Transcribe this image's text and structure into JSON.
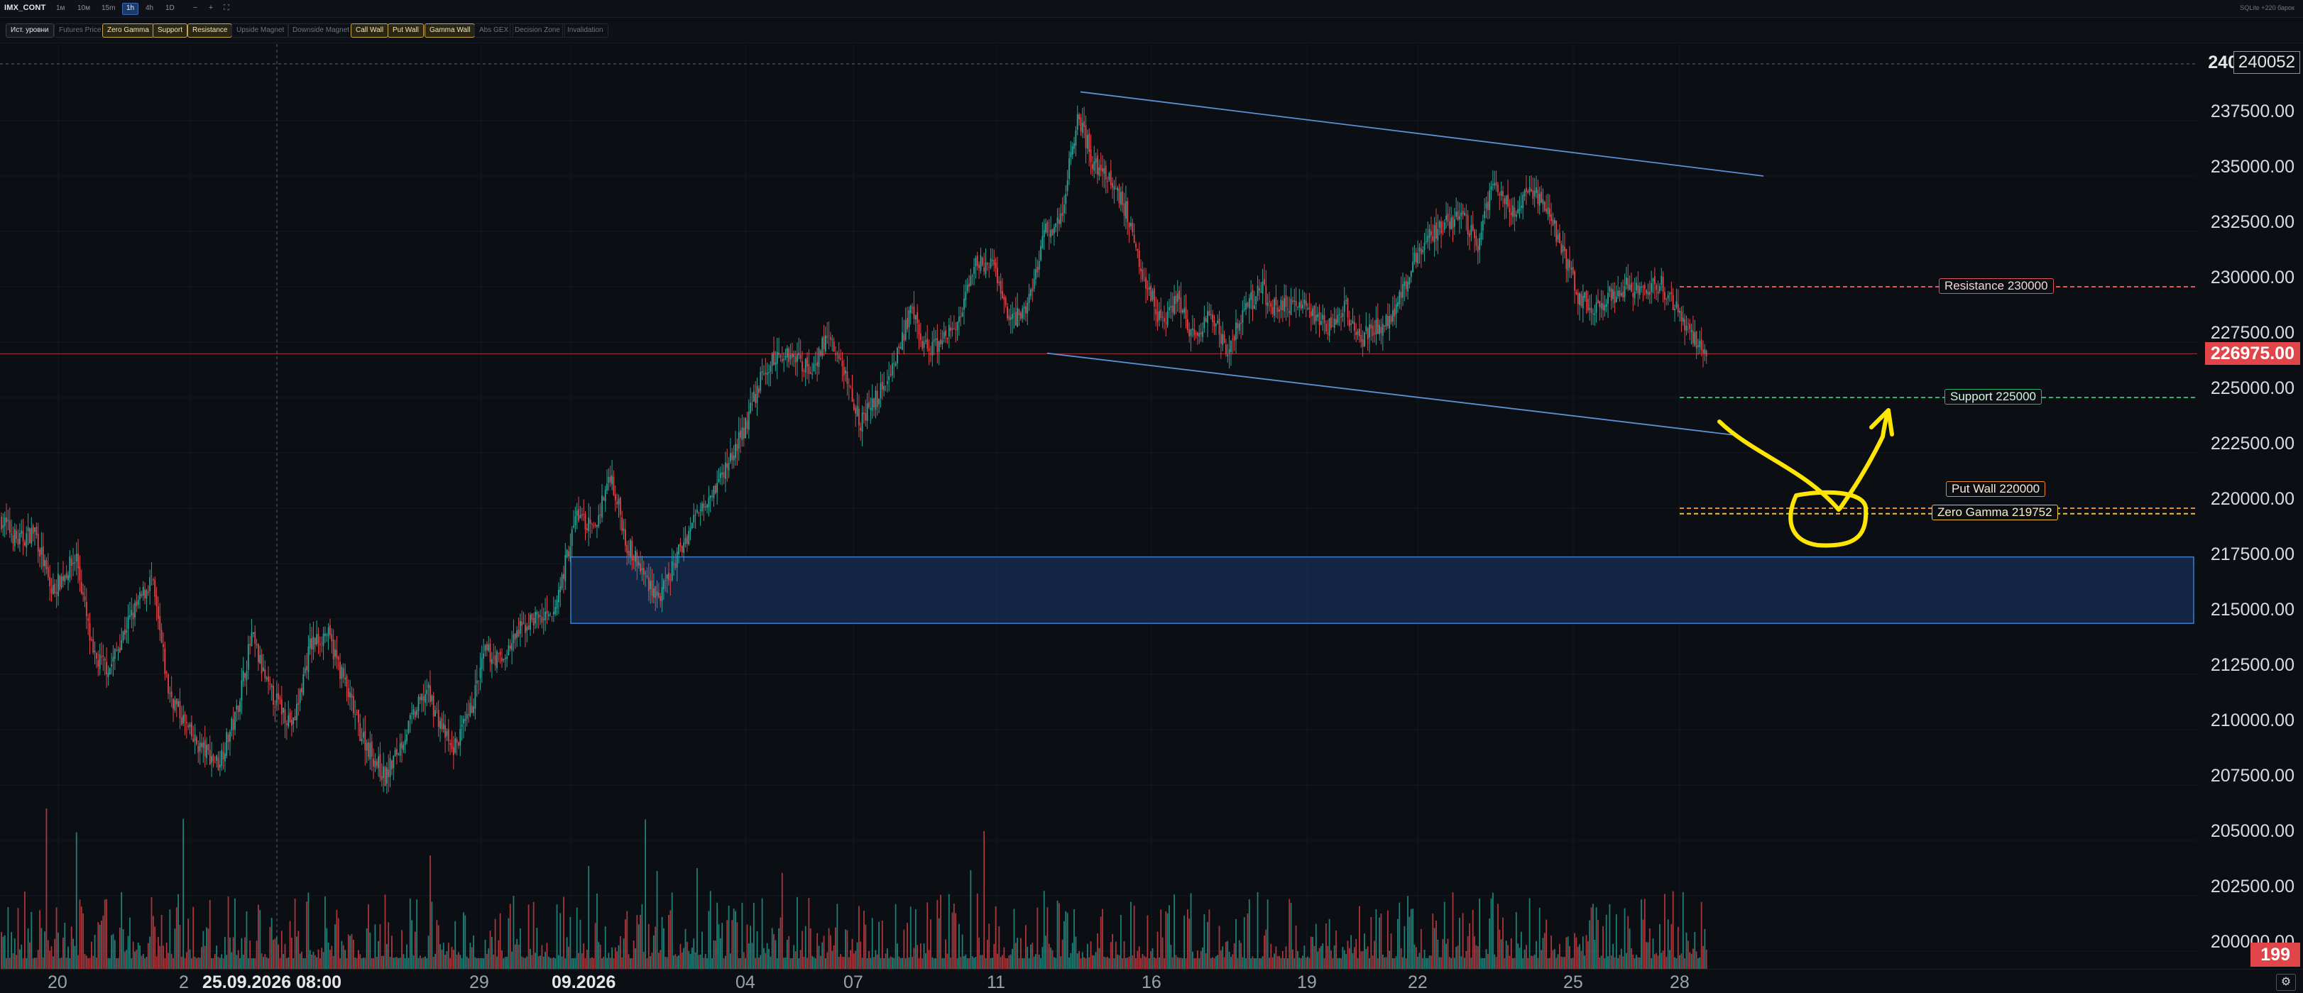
{
  "app": {
    "symbol": "IMX_CONT",
    "timeframes": [
      "1м",
      "10м",
      "15m",
      "1h",
      "4h",
      "1D"
    ],
    "active_timeframe": "1h",
    "top_right_text": "SQLite  +220 барок"
  },
  "layers": [
    {
      "label": "Ист. уровни",
      "state": "plain"
    },
    {
      "label": "Futures Price",
      "state": "off"
    },
    {
      "label": "Zero Gamma",
      "state": "on"
    },
    {
      "label": "Support",
      "state": "on"
    },
    {
      "label": "Resistance",
      "state": "on"
    },
    {
      "label": "Upside Magnet",
      "state": "off"
    },
    {
      "label": "Downside Magnet",
      "state": "off"
    },
    {
      "label": "Call Wall",
      "state": "on"
    },
    {
      "label": "Put Wall",
      "state": "on"
    },
    {
      "label": "Gamma Wall",
      "state": "on"
    },
    {
      "label": "Abs GEX",
      "state": "off"
    },
    {
      "label": "Decision Zone",
      "state": "off"
    },
    {
      "label": "Invalidation",
      "state": "off"
    }
  ],
  "price_axis": {
    "ticks": [
      "237500.00",
      "235000.00",
      "232500.00",
      "230000.00",
      "227500.00",
      "225000.00",
      "222500.00",
      "220000.00",
      "217500.00",
      "215000.00",
      "212500.00",
      "210000.00",
      "207500.00",
      "205000.00",
      "202500.00",
      "200000.00"
    ],
    "top_cut_label": "240",
    "top_tag": "240052",
    "current_price": "226975.00",
    "volume_tag": "199"
  },
  "levels": {
    "resistance": "Resistance 230000",
    "support": "Support 225000",
    "put_wall": "Put Wall 220000",
    "zero_gamma": "Zero Gamma 219752"
  },
  "time_axis": [
    {
      "label": "20"
    },
    {
      "label": "2"
    },
    {
      "label": "25.09.2026 08:00",
      "bold": true
    },
    {
      "label": "29"
    },
    {
      "label": "09.2026",
      "bold": true
    },
    {
      "label": "04"
    },
    {
      "label": "07"
    },
    {
      "label": "11"
    },
    {
      "label": "16"
    },
    {
      "label": "19"
    },
    {
      "label": "22"
    },
    {
      "label": "25"
    },
    {
      "label": "28"
    }
  ],
  "colors": {
    "background": "#0b0e13",
    "bull": "#26a69a",
    "bear": "#e0454a",
    "resistance": "#e0545a",
    "support": "#2fb36c",
    "put_wall": "#ee8a2e",
    "zero_gamma": "#f2c12e",
    "channel": "#5b8fd6",
    "zone_fill": "#1a3a6b",
    "annotation": "#ffe600"
  },
  "chart_data": {
    "type": "candlestick",
    "y_range": [
      199000,
      241000
    ],
    "current_price": 226975,
    "levels": [
      {
        "name": "Resistance",
        "value": 230000
      },
      {
        "name": "Support",
        "value": 225000
      },
      {
        "name": "Put Wall",
        "value": 220000
      },
      {
        "name": "Zero Gamma",
        "value": 219752
      }
    ],
    "zone": {
      "low": 214800,
      "high": 217800
    },
    "price_path": [
      [
        0,
        219500
      ],
      [
        10,
        218500
      ],
      [
        20,
        219000
      ],
      [
        30,
        216200
      ],
      [
        45,
        217800
      ],
      [
        55,
        213200
      ],
      [
        65,
        212800
      ],
      [
        75,
        214700
      ],
      [
        90,
        216800
      ],
      [
        100,
        211800
      ],
      [
        115,
        209500
      ],
      [
        130,
        208500
      ],
      [
        140,
        210500
      ],
      [
        150,
        214200
      ],
      [
        160,
        211800
      ],
      [
        175,
        210200
      ],
      [
        185,
        213800
      ],
      [
        195,
        214400
      ],
      [
        205,
        212300
      ],
      [
        215,
        209900
      ],
      [
        230,
        207800
      ],
      [
        245,
        210300
      ],
      [
        255,
        211800
      ],
      [
        270,
        209000
      ],
      [
        280,
        210500
      ],
      [
        290,
        213500
      ],
      [
        300,
        213100
      ],
      [
        310,
        214400
      ],
      [
        320,
        215100
      ],
      [
        330,
        214900
      ],
      [
        345,
        219800
      ],
      [
        355,
        218900
      ],
      [
        365,
        221600
      ],
      [
        375,
        218400
      ],
      [
        385,
        217000
      ],
      [
        395,
        215900
      ],
      [
        405,
        217800
      ],
      [
        420,
        220300
      ],
      [
        430,
        221200
      ],
      [
        445,
        223500
      ],
      [
        455,
        225800
      ],
      [
        465,
        226900
      ],
      [
        475,
        227000
      ],
      [
        485,
        226200
      ],
      [
        495,
        227800
      ],
      [
        505,
        226200
      ],
      [
        515,
        223900
      ],
      [
        525,
        225000
      ],
      [
        535,
        226600
      ],
      [
        545,
        228800
      ],
      [
        555,
        227100
      ],
      [
        565,
        227600
      ],
      [
        575,
        228600
      ],
      [
        585,
        231200
      ],
      [
        595,
        230800
      ],
      [
        605,
        228400
      ],
      [
        615,
        229100
      ],
      [
        625,
        232400
      ],
      [
        635,
        233000
      ],
      [
        645,
        237900
      ],
      [
        655,
        235500
      ],
      [
        665,
        234800
      ],
      [
        675,
        233300
      ],
      [
        685,
        230500
      ],
      [
        695,
        228400
      ],
      [
        705,
        229600
      ],
      [
        715,
        227500
      ],
      [
        725,
        228700
      ],
      [
        735,
        227100
      ],
      [
        745,
        228900
      ],
      [
        755,
        229900
      ],
      [
        765,
        228900
      ],
      [
        775,
        229300
      ],
      [
        785,
        228900
      ],
      [
        795,
        228100
      ],
      [
        805,
        229100
      ],
      [
        815,
        227600
      ],
      [
        825,
        228200
      ],
      [
        835,
        228900
      ],
      [
        845,
        230800
      ],
      [
        855,
        232300
      ],
      [
        865,
        232900
      ],
      [
        875,
        233200
      ],
      [
        885,
        231900
      ],
      [
        895,
        235000
      ],
      [
        905,
        233100
      ],
      [
        915,
        234400
      ],
      [
        925,
        233800
      ],
      [
        935,
        231900
      ],
      [
        945,
        229500
      ],
      [
        955,
        229100
      ],
      [
        965,
        229600
      ],
      [
        975,
        230000
      ],
      [
        985,
        229900
      ],
      [
        995,
        230100
      ],
      [
        1005,
        228900
      ],
      [
        1015,
        227700
      ],
      [
        1022,
        226975
      ]
    ]
  }
}
